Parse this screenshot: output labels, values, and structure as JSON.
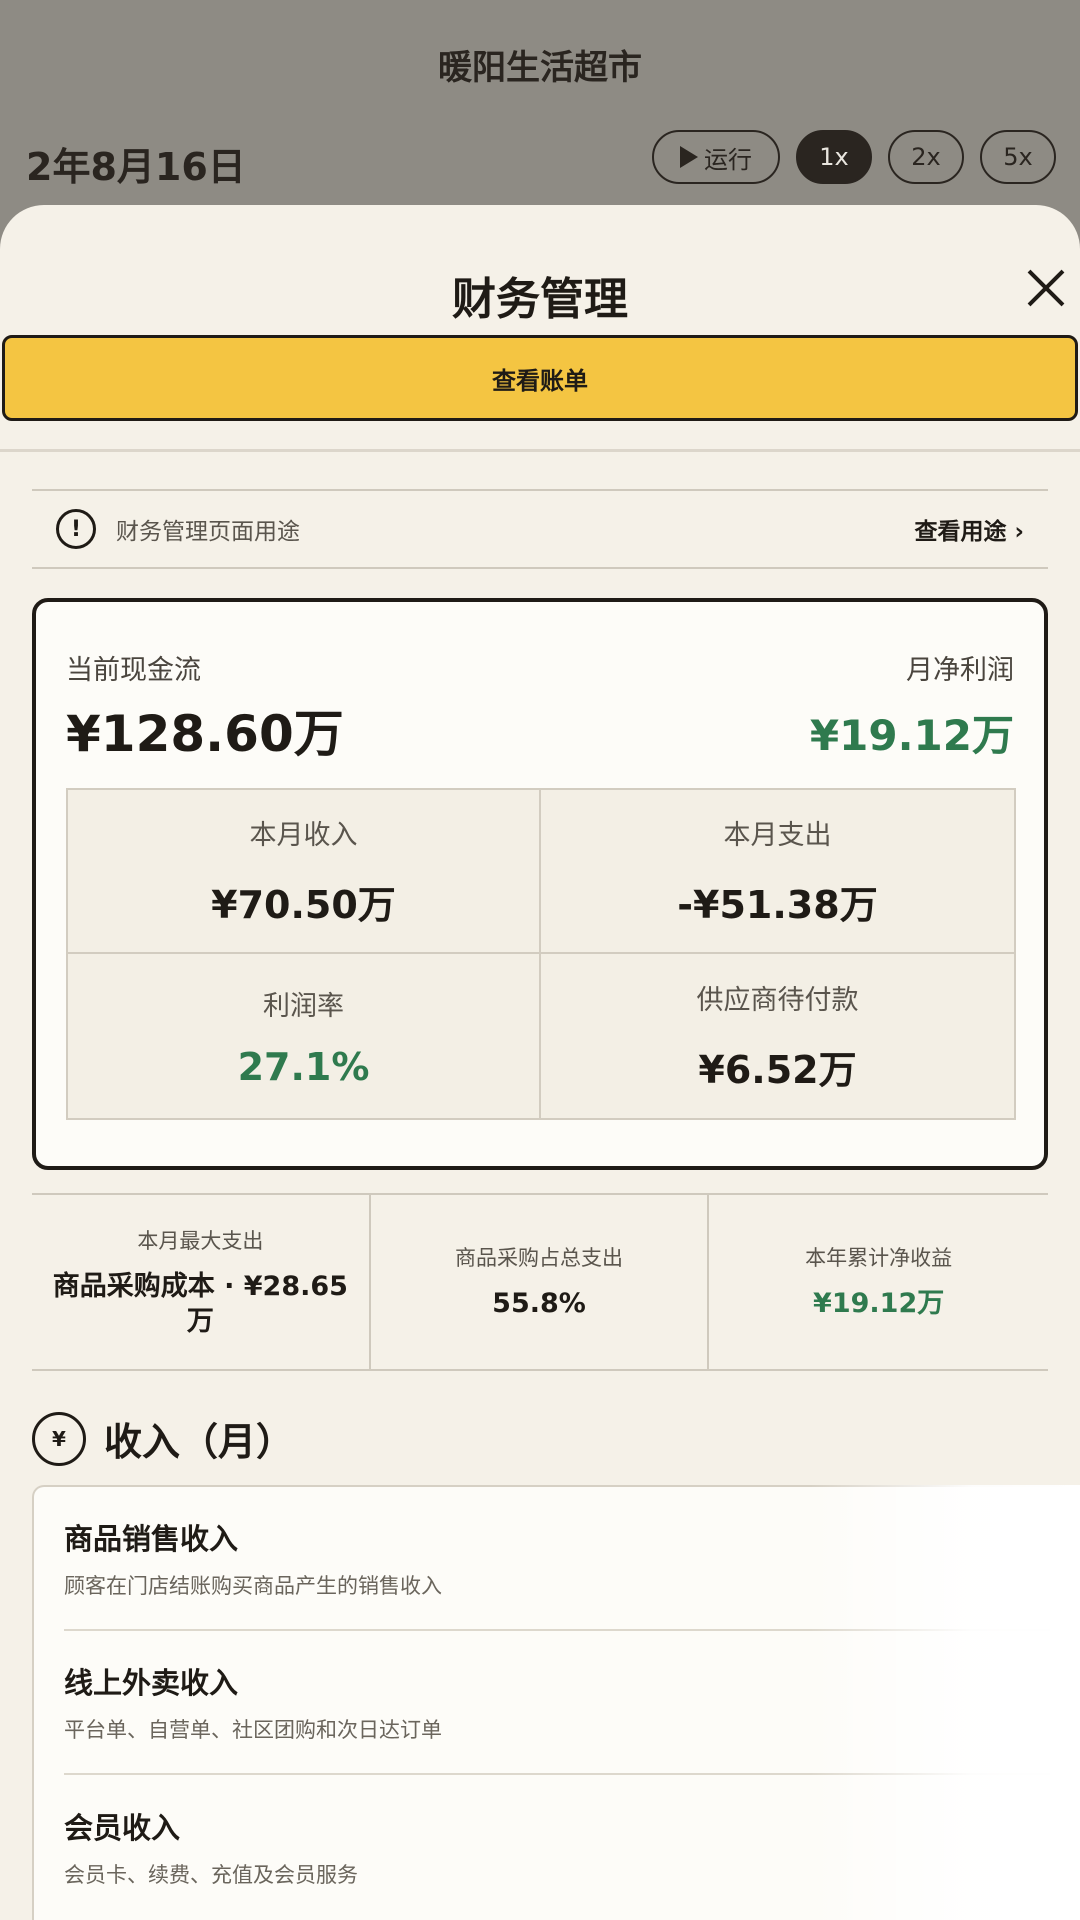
{
  "header": {
    "store_name": "暖阳生活超市",
    "date": "2年8月16日",
    "run_label": "运行",
    "speeds": [
      "1x",
      "2x",
      "5x"
    ],
    "active_speed": "1x"
  },
  "sheet": {
    "title": "财务管理",
    "bill_button": "查看账单",
    "purpose": {
      "text": "财务管理页面用途",
      "link": "查看用途 ›"
    }
  },
  "summary": {
    "cash_label": "当前现金流",
    "cash_value": "¥128.60万",
    "profit_label": "月净利润",
    "profit_value": "¥19.12万",
    "metrics": [
      {
        "label": "本月收入",
        "value": "¥70.50万"
      },
      {
        "label": "本月支出",
        "value": "-¥51.38万"
      },
      {
        "label": "利润率",
        "value": "27.1%"
      },
      {
        "label": "供应商待付款",
        "value": "¥6.52万"
      }
    ]
  },
  "stats": [
    {
      "label": "本月最大支出",
      "value": "商品采购成本 · ¥28.65万"
    },
    {
      "label": "商品采购占总支出",
      "value": "55.8%"
    },
    {
      "label": "本年累计净收益",
      "value": "¥19.12万"
    }
  ],
  "income": {
    "icon_glyph": "¥",
    "title": "收入（月）",
    "items": [
      {
        "name": "商品销售收入",
        "desc": "顾客在门店结账购买商品产生的销售收入"
      },
      {
        "name": "线上外卖收入",
        "desc": "平台单、自营单、社区团购和次日达订单"
      },
      {
        "name": "会员收入",
        "desc": "会员卡、续费、充值及会员服务"
      }
    ]
  },
  "colors": {
    "accent_yellow": "#f4c542",
    "positive_green": "#2f7a4e",
    "sheet_bg": "#f5f1e8",
    "backdrop": "#8e8b84"
  }
}
